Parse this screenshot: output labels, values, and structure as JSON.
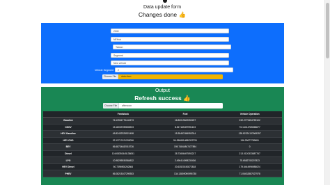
{
  "header": {
    "title": "Data update form",
    "subtitle": "Changes done",
    "subtitle_emoji": "👍"
  },
  "form": {
    "fields": [
      {
        "label": "Target Year",
        "value": "2040"
      },
      {
        "label": "Region",
        "value": "NEHub"
      },
      {
        "label": "Country Selection",
        "value": "Taiwan"
      },
      {
        "label": "Mode Selection",
        "value": "Segment"
      },
      {
        "label": "Fleet Selection",
        "value": "New vehicle"
      },
      {
        "label": "Vehicle Segment",
        "value": "2"
      }
    ],
    "file_button": "Choose File",
    "file_name": "data.xlsm",
    "accent_color": "#0d6efd",
    "file_color": "#f0b400"
  },
  "output": {
    "title": "Output",
    "subtitle": "Refresh success",
    "subtitle_emoji": "👍",
    "file_button": "Choose File",
    "file_name": "aftersoon",
    "accent_color": "#198754",
    "table": {
      "headers": [
        "",
        "Feedstock",
        "Fuel",
        "Vehicle Operation"
      ],
      "rows": [
        [
          "Gasoline",
          "76.13904775441573",
          "16.80019622050207",
          "232.2779454759102"
        ],
        [
          "CNGV",
          "15.18003789806923",
          "8.817165497591103",
          "76.14414765368677"
        ],
        [
          "HEV Gasoline",
          "45.82432325521498",
          "15.35457456953314",
          "135.82224137669257"
        ],
        [
          "HEV CNG",
          "32.13717421203096",
          "54.0566814880322791",
          "196.25677789651"
        ],
        [
          "BEV",
          "56.68734482015726",
          "195.74844847477894",
          "0"
        ],
        [
          "Diesel",
          "10.608392445138051",
          "28.73656497893217",
          "213.0120333887767"
        ],
        [
          "LPG",
          "10.98295930584832",
          "2.496414098230436",
          "75.6582753207823"
        ],
        [
          "HEV Diesel",
          "50.7396908262864",
          "20.63520150872818",
          "179.6444996988024"
        ],
        [
          "PHEV",
          "56.08215107299353",
          "134.13809090995738",
          "71.06432887027978"
        ]
      ]
    }
  }
}
